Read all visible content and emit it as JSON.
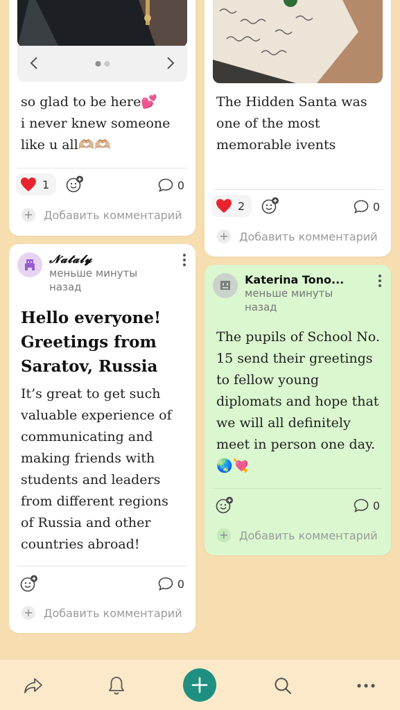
{
  "colors": {
    "page_background": "#f6deb0",
    "accent": "#1f8f81",
    "like_red": "#e8232d",
    "green_card": "#daf7cf"
  },
  "posts": [
    {
      "body": [
        "so glad to be here💕",
        "i never knew someone",
        "like u all🫶🏼🫶🏼"
      ],
      "likes": "1",
      "comments": "0",
      "add_comment": "Добавить комментарий",
      "carousel": {
        "pages": 2,
        "current": 1
      }
    },
    {
      "body": [
        "The Hidden Santa was",
        "one of the most",
        "memorable ivents"
      ],
      "likes": "2",
      "comments": "0",
      "add_comment": "Добавить комментарий"
    },
    {
      "author": "𝓝𝓪𝓽𝓪𝓵𝔂",
      "time": "меньше минуты назад",
      "title": [
        "Hello everyone!",
        "Greetings from",
        "Saratov, Russia"
      ],
      "body": [
        "It’s great to get such",
        "valuable experience of",
        "communicating and",
        "making friends with",
        "students and leaders",
        "from different regions",
        "of Russia and other",
        "countries abroad!"
      ],
      "comments": "0",
      "add_comment": "Добавить комментарий"
    },
    {
      "author": "Katerina Tono...",
      "time": "меньше минуты назад",
      "body": [
        "The pupils of School No.",
        "15 send their greetings",
        "to fellow young",
        "diplomats and hope that",
        "we will all definitely",
        "meet in person one day.",
        "🌏💘"
      ],
      "comments": "0",
      "add_comment": "Добавить комментарий"
    }
  ],
  "bottom_nav": [
    "share-icon",
    "bell-icon",
    "add-icon",
    "search-icon",
    "more-icon"
  ]
}
